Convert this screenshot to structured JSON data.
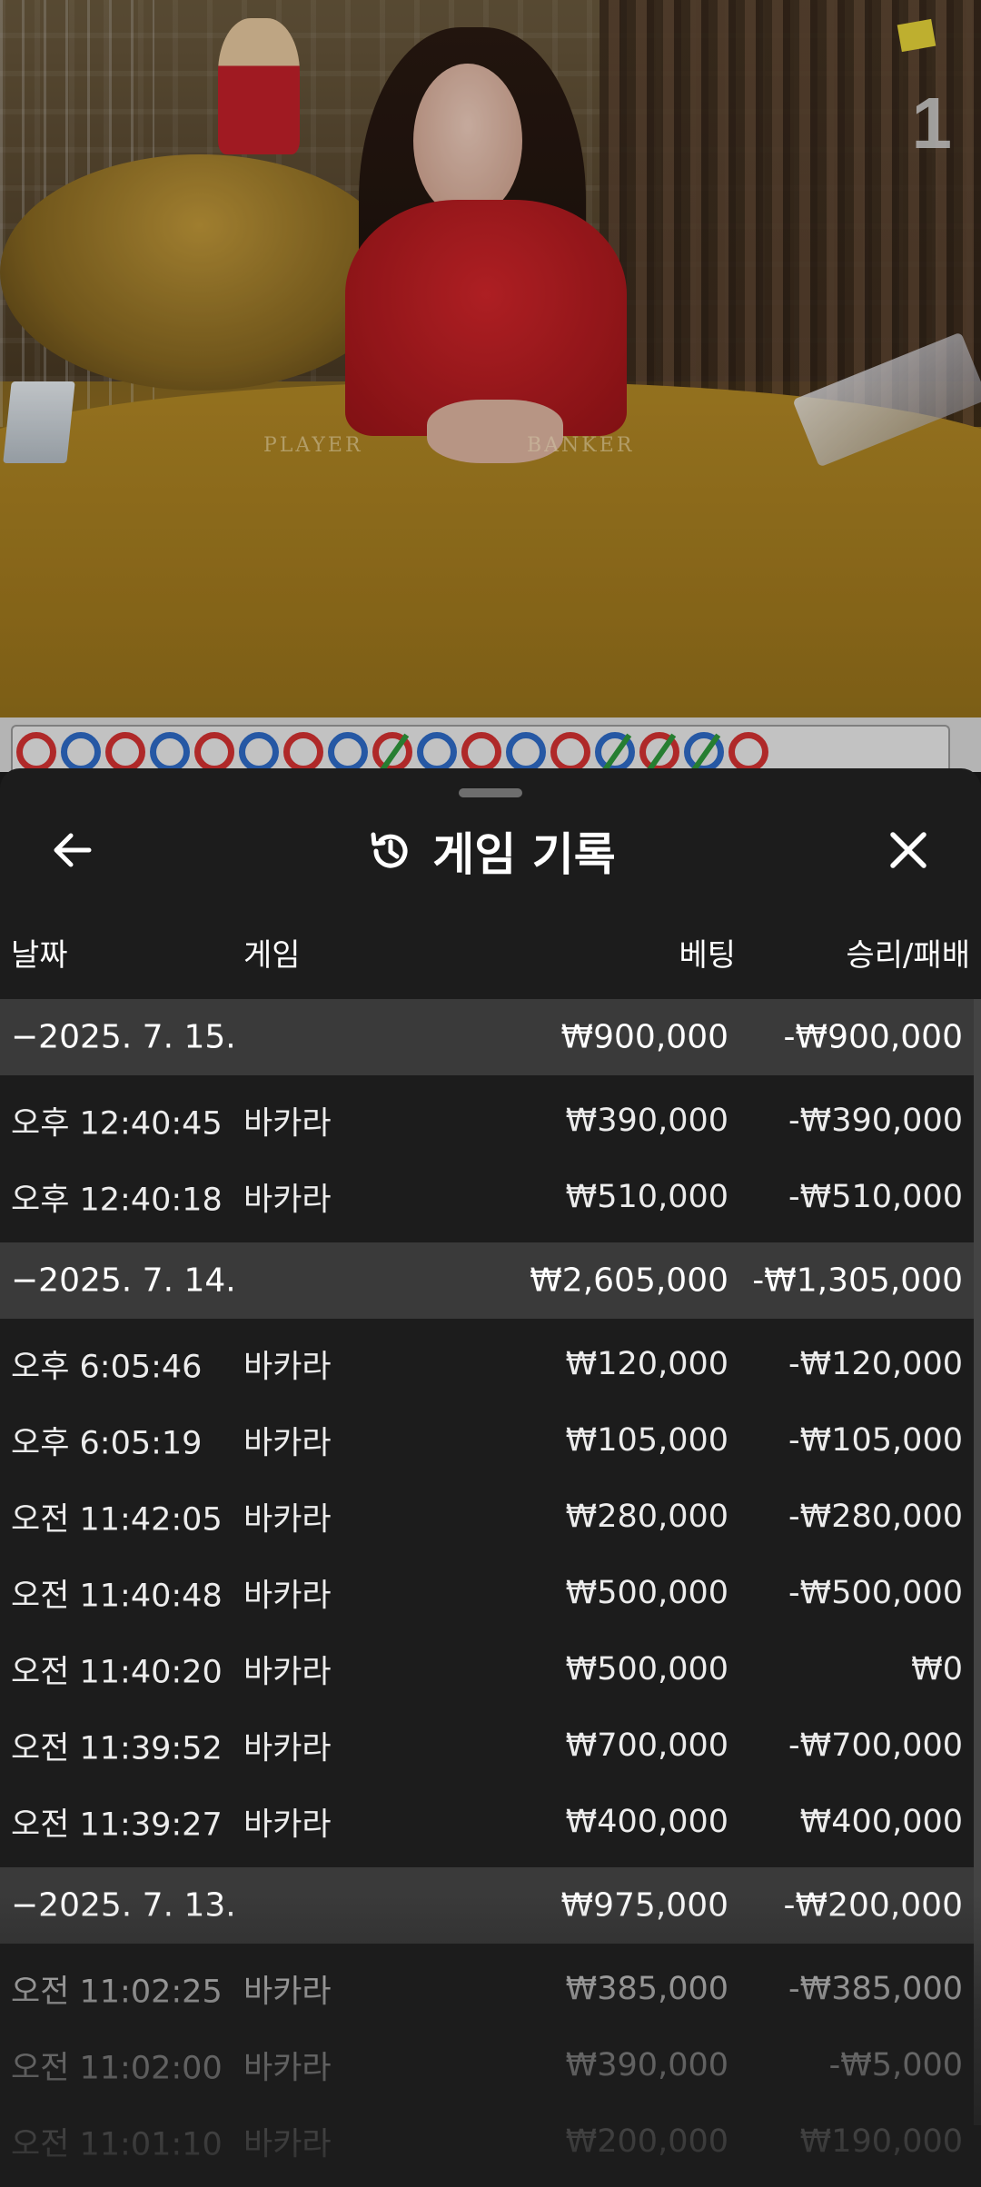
{
  "video": {
    "round_number": "1",
    "felt_player": "PLAYER",
    "felt_banker": "BANKER"
  },
  "roadmap": {
    "results": [
      "P",
      "B",
      "P",
      "B",
      "P",
      "B-dot",
      "P",
      "B",
      "P-tie",
      "B-dot",
      "P",
      "B-dot",
      "P",
      "B-tie",
      "P-tie",
      "B-tie",
      "P"
    ],
    "player_color": "#d63333",
    "banker_color": "#2f6cc8",
    "tie_color": "#2f9a3c"
  },
  "sheet": {
    "title": "게임 기록",
    "back_icon": "arrow-left-icon",
    "history_icon": "history-icon",
    "close_icon": "close-icon"
  },
  "columns": {
    "date": "날짜",
    "game": "게임",
    "bet": "베팅",
    "win_loss": "승리/패배"
  },
  "groups": [
    {
      "date": "2025. 7. 15.",
      "bet": "₩900,000",
      "win_loss": "-₩900,000",
      "rows": [
        {
          "time": "오후 12:40:45",
          "game": "바카라",
          "bet": "₩390,000",
          "win_loss": "-₩390,000"
        },
        {
          "time": "오후 12:40:18",
          "game": "바카라",
          "bet": "₩510,000",
          "win_loss": "-₩510,000"
        }
      ]
    },
    {
      "date": "2025. 7. 14.",
      "bet": "₩2,605,000",
      "win_loss": "-₩1,305,000",
      "rows": [
        {
          "time": "오후 6:05:46",
          "game": "바카라",
          "bet": "₩120,000",
          "win_loss": "-₩120,000"
        },
        {
          "time": "오후 6:05:19",
          "game": "바카라",
          "bet": "₩105,000",
          "win_loss": "-₩105,000"
        },
        {
          "time": "오전 11:42:05",
          "game": "바카라",
          "bet": "₩280,000",
          "win_loss": "-₩280,000"
        },
        {
          "time": "오전 11:40:48",
          "game": "바카라",
          "bet": "₩500,000",
          "win_loss": "-₩500,000"
        },
        {
          "time": "오전 11:40:20",
          "game": "바카라",
          "bet": "₩500,000",
          "win_loss": "₩0"
        },
        {
          "time": "오전 11:39:52",
          "game": "바카라",
          "bet": "₩700,000",
          "win_loss": "-₩700,000"
        },
        {
          "time": "오전 11:39:27",
          "game": "바카라",
          "bet": "₩400,000",
          "win_loss": "₩400,000"
        }
      ]
    },
    {
      "date": "2025. 7. 13.",
      "bet": "₩975,000",
      "win_loss": "-₩200,000",
      "rows": [
        {
          "time": "오전 11:02:25",
          "game": "바카라",
          "bet": "₩385,000",
          "win_loss": "-₩385,000"
        },
        {
          "time": "오전 11:02:00",
          "game": "바카라",
          "bet": "₩390,000",
          "win_loss": "-₩5,000"
        },
        {
          "time": "오전 11:01:10",
          "game": "바카라",
          "bet": "₩200,000",
          "win_loss": "₩190,000"
        }
      ]
    }
  ]
}
